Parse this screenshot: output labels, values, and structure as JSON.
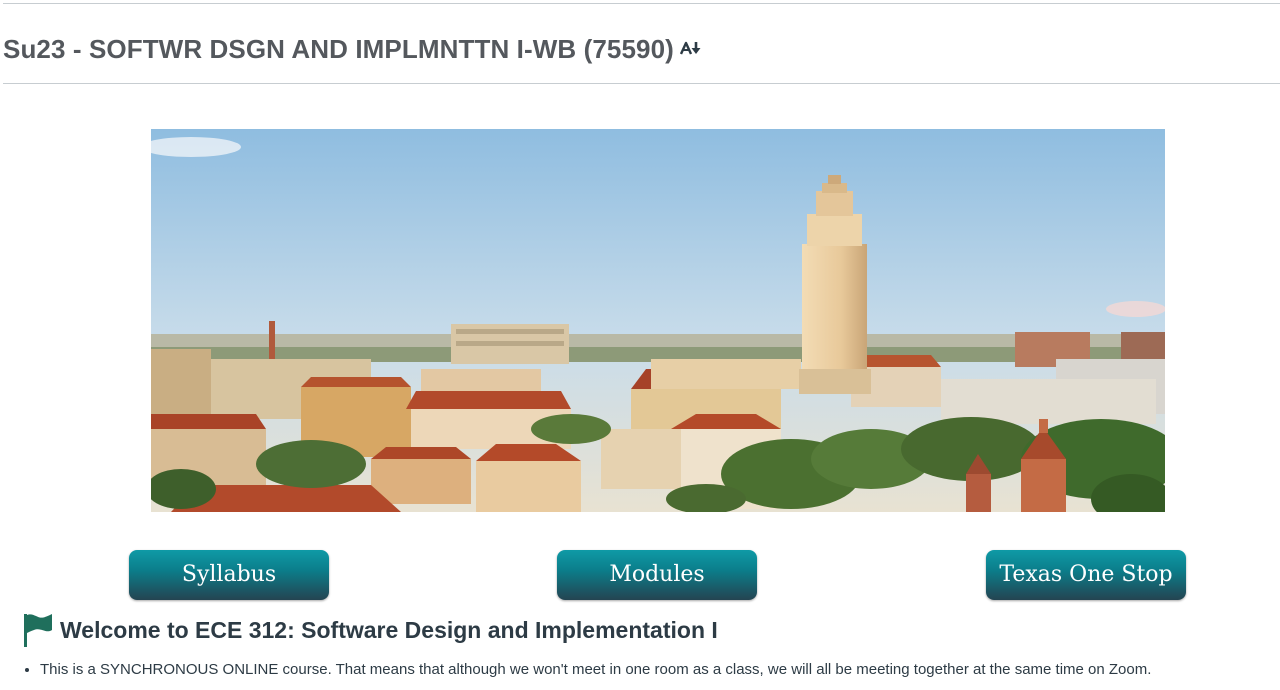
{
  "course": {
    "title": "Su23 - SOFTWR DSGN AND IMPLMNTTN I-WB (75590)",
    "reader_icon": "immersive-reader-icon"
  },
  "banner": {
    "image": "campus-panorama-image",
    "subject": "University campus aerial view with clock tower"
  },
  "nav_buttons": [
    {
      "label": "Syllabus"
    },
    {
      "label": "Modules"
    },
    {
      "label": "Texas One Stop"
    }
  ],
  "welcome": {
    "icon": "flag-icon",
    "heading": "Welcome to ECE 312: Software Design and Implementation I",
    "bullets": [
      "This is a SYNCHRONOUS ONLINE course. That means that although we won't meet in one room as a class, we will all be meeting together at the same time on Zoom."
    ]
  },
  "colors": {
    "title": "#54585d",
    "button_top": "#0f9aa6",
    "button_bottom": "#244451",
    "flag": "#1f6f5c",
    "body_text": "#2d3b45"
  }
}
